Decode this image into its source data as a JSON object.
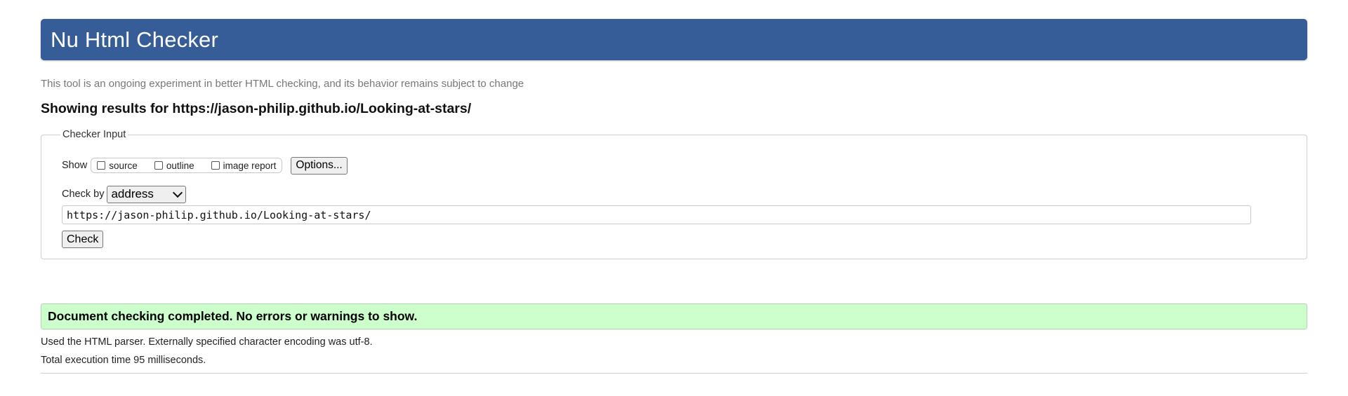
{
  "header": {
    "title": "Nu Html Checker",
    "background_color": "#365d98"
  },
  "subtitle": "This tool is an ongoing experiment in better HTML checking, and its behavior remains subject to change",
  "results_heading": "Showing results for https://jason-philip.github.io/Looking-at-stars/",
  "checker_input": {
    "legend": "Checker Input",
    "show_label": "Show",
    "show_options": [
      {
        "label": "source",
        "checked": false
      },
      {
        "label": "outline",
        "checked": false
      },
      {
        "label": "image report",
        "checked": false
      }
    ],
    "options_button": "Options...",
    "check_by_label": "Check by",
    "check_by_selected": "address",
    "url_value": "https://jason-philip.github.io/Looking-at-stars/",
    "check_button": "Check"
  },
  "result": {
    "message": "Document checking completed. No errors or warnings to show.",
    "background_color": "#ccffcc"
  },
  "info": {
    "parser_line": "Used the HTML parser. Externally specified character encoding was utf-8.",
    "execution_line": "Total execution time 95 milliseconds."
  }
}
